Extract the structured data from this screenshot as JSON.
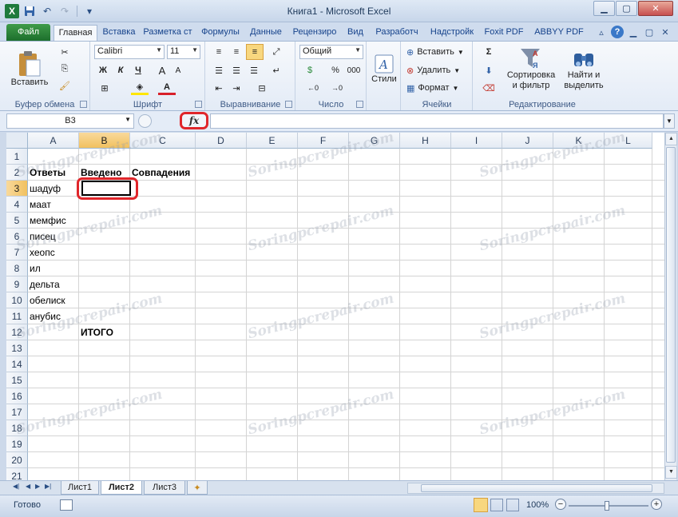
{
  "window": {
    "title": "Книга1 - Microsoft Excel",
    "minimize": "▁",
    "maximize": "▢",
    "close": "✕"
  },
  "ribbon_tabs": [
    {
      "label": "Файл"
    },
    {
      "label": "Главная"
    },
    {
      "label": "Вставка"
    },
    {
      "label": "Разметка ст"
    },
    {
      "label": "Формулы"
    },
    {
      "label": "Данные"
    },
    {
      "label": "Рецензиро"
    },
    {
      "label": "Вид"
    },
    {
      "label": "Разработч"
    },
    {
      "label": "Надстройк"
    },
    {
      "label": "Foxit PDF"
    },
    {
      "label": "ABBYY PDF"
    }
  ],
  "ribbon": {
    "clipboard": {
      "label": "Буфер обмена",
      "paste": "Вставить"
    },
    "font": {
      "label": "Шрифт",
      "name": "Calibri",
      "size": "11",
      "bold": "Ж",
      "italic": "К",
      "underline": "Ч",
      "grow": "A",
      "shrink": "A"
    },
    "alignment": {
      "label": "Выравнивание"
    },
    "number": {
      "label": "Число",
      "format": "Общий",
      "percent": "%",
      "thousands": "000"
    },
    "styles": {
      "label": "Стили"
    },
    "cells": {
      "label": "Ячейки",
      "insert": "Вставить",
      "delete": "Удалить",
      "format": "Формат"
    },
    "editing": {
      "label": "Редактирование",
      "sigma": "Σ",
      "sort": "Сортировка",
      "sort2": "и фильтр",
      "find": "Найти и",
      "find2": "выделить"
    }
  },
  "formula_bar": {
    "name_box": "B3",
    "fx": "fx",
    "value": ""
  },
  "columns": [
    "A",
    "B",
    "C",
    "D",
    "E",
    "F",
    "G",
    "H",
    "I",
    "J",
    "K",
    "L"
  ],
  "rows": [
    "1",
    "2",
    "3",
    "4",
    "5",
    "6",
    "7",
    "8",
    "9",
    "10",
    "11",
    "12",
    "13",
    "14",
    "15",
    "16",
    "17",
    "18",
    "19",
    "20",
    "21"
  ],
  "cells": {
    "A2": "Ответы",
    "B2": "Введено",
    "C2": "Совпадения",
    "A3": "шадуф",
    "A4": "маат",
    "A5": "мемфис",
    "A6": "писец",
    "A7": "хеопс",
    "A8": "ил",
    "A9": "дельта",
    "A10": "обелиск",
    "A11": "анубис",
    "B12": "ИТОГО"
  },
  "watermark": "Soringpcrepair.com",
  "sheet_tabs": [
    {
      "label": "Лист1"
    },
    {
      "label": "Лист2"
    },
    {
      "label": "Лист3"
    }
  ],
  "status": {
    "ready": "Готово",
    "zoom": "100%",
    "zoom_out": "−",
    "zoom_in": "+"
  }
}
